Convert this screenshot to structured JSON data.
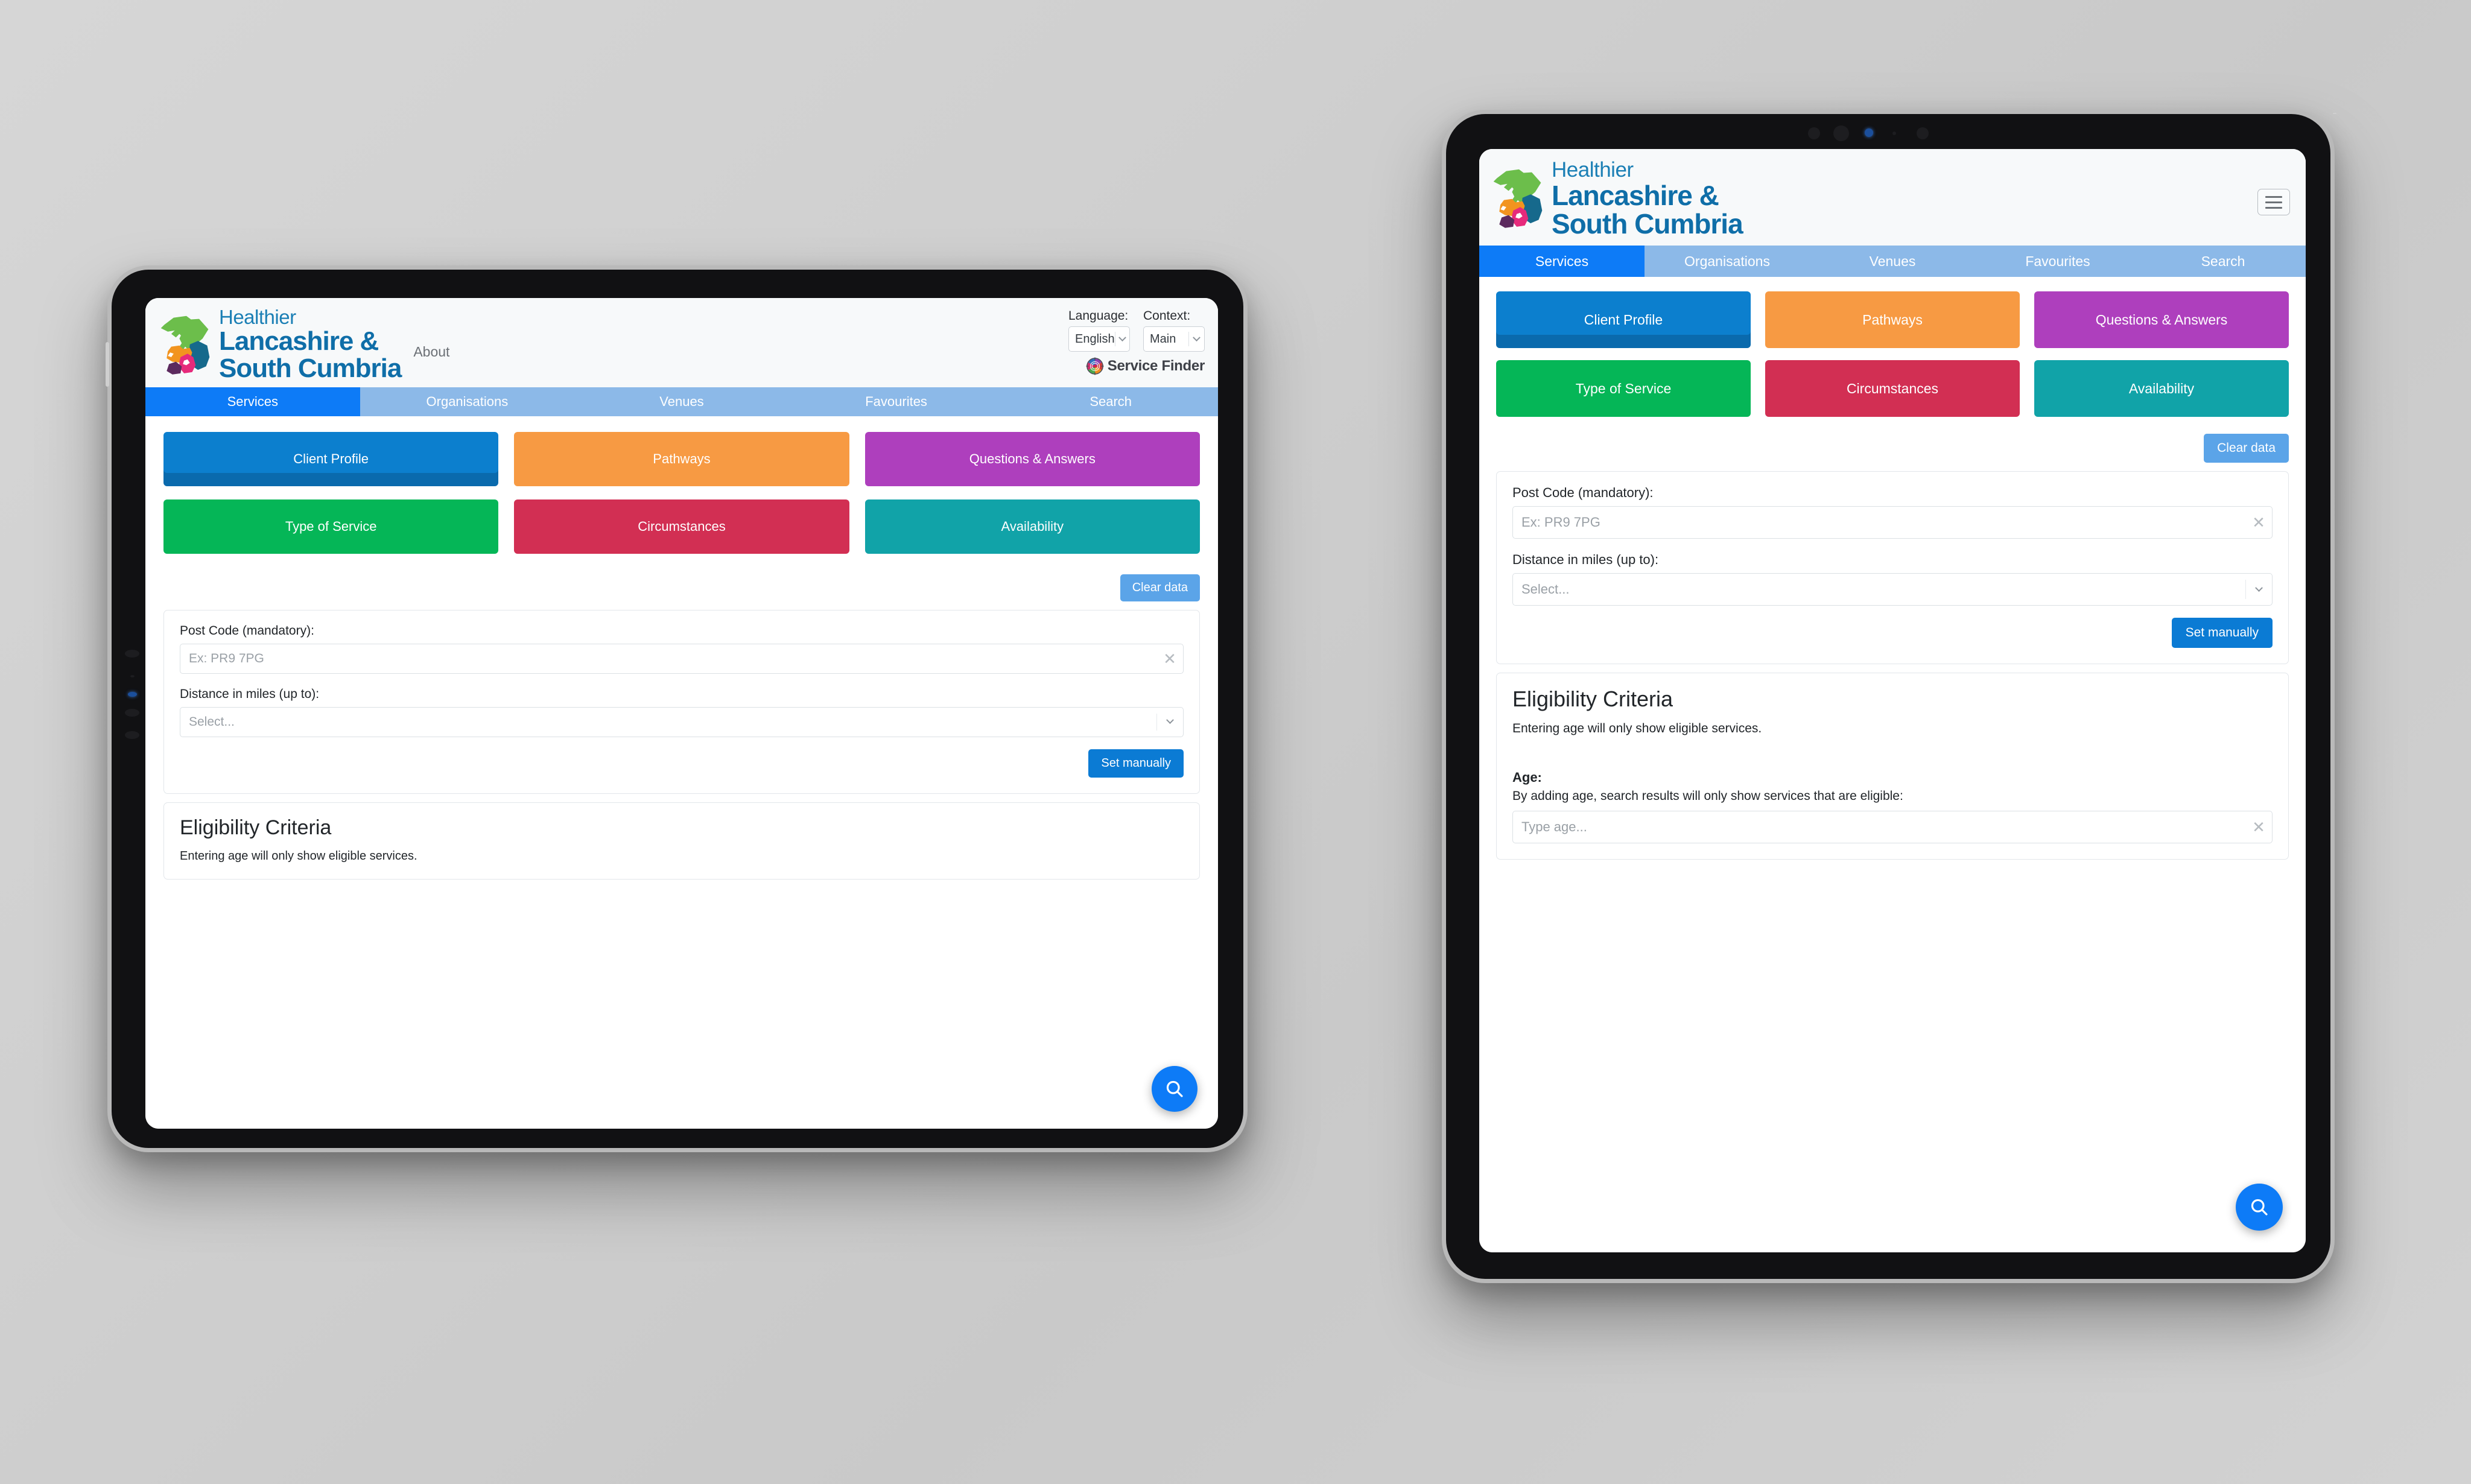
{
  "brand": {
    "line1": "Healthier",
    "line2": "Lancashire &",
    "line3": "South Cumbria",
    "service_finder": "Service Finder",
    "logo_colors": {
      "green": "#6cbe4b",
      "teal": "#16698c",
      "orange": "#f2941f",
      "pink": "#e62a7b",
      "purple": "#5c2a5e"
    }
  },
  "header": {
    "about_label": "About",
    "language_label": "Language:",
    "language_value": "English",
    "context_label": "Context:",
    "context_value": "Main",
    "menu_icon": "hamburger-icon"
  },
  "nav": {
    "tabs": [
      {
        "label": "Services",
        "active": true
      },
      {
        "label": "Organisations",
        "active": false
      },
      {
        "label": "Venues",
        "active": false
      },
      {
        "label": "Favourites",
        "active": false
      },
      {
        "label": "Search",
        "active": false
      }
    ],
    "active_color": "#0d7bf7",
    "inactive_color": "#8cb9e8"
  },
  "categories": [
    {
      "label": "Client Profile",
      "color": "#0c7fce",
      "class": "c-blue"
    },
    {
      "label": "Pathways",
      "color": "#f79a43",
      "class": "c-orange"
    },
    {
      "label": "Questions & Answers",
      "color": "#ae3fbd",
      "class": "c-purple"
    },
    {
      "label": "Type of Service",
      "color": "#05b657",
      "class": "c-green"
    },
    {
      "label": "Circumstances",
      "color": "#d22f53",
      "class": "c-red"
    },
    {
      "label": "Availability",
      "color": "#11a3a8",
      "class": "c-teal"
    }
  ],
  "location_panel": {
    "clear_data_label": "Clear data",
    "postcode_label": "Post Code (mandatory):",
    "postcode_placeholder": "Ex: PR9 7PG",
    "postcode_value": "",
    "distance_label": "Distance in miles (up to):",
    "distance_placeholder": "Select...",
    "distance_value": "",
    "set_manually_label": "Set manually"
  },
  "eligibility_panel": {
    "title": "Eligibility Criteria",
    "subtitle": "Entering age will only show eligible services.",
    "age_label": "Age:",
    "age_help": "By adding age, search results will only show services that are eligible:",
    "age_placeholder": "Type age...",
    "age_value": ""
  },
  "fab": {
    "icon": "search-icon",
    "color": "#0d7bf7"
  }
}
